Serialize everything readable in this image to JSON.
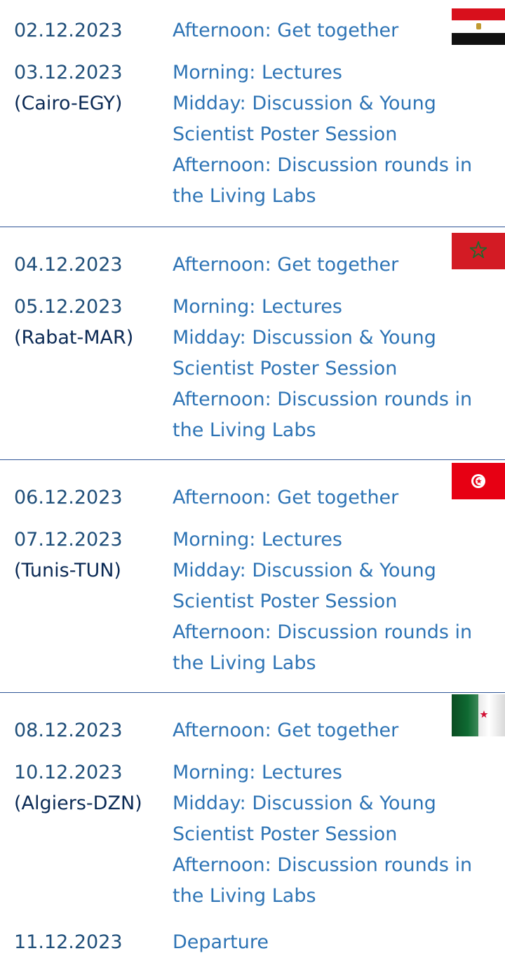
{
  "sections": [
    {
      "flag": "egypt-flag",
      "get_together": {
        "date": "02.12.2023",
        "text": "Afternoon: Get together"
      },
      "main_day": {
        "date": "03.12.2023",
        "city": "(Cairo-EGY)",
        "lines": [
          "Morning: Lectures",
          "Midday:  Discussion & Young",
          "Scientist Poster Session",
          "Afternoon: Discussion rounds in",
          "the Living Labs"
        ]
      }
    },
    {
      "flag": "morocco-flag",
      "get_together": {
        "date": "04.12.2023",
        "text": "Afternoon: Get together"
      },
      "main_day": {
        "date": "05.12.2023",
        "city": "(Rabat-MAR)",
        "lines": [
          "Morning: Lectures",
          "Midday:  Discussion & Young",
          "Scientist Poster Session",
          "Afternoon: Discussion rounds in",
          "the Living Labs"
        ]
      }
    },
    {
      "flag": "tunisia-flag",
      "get_together": {
        "date": "06.12.2023",
        "text": "Afternoon: Get together"
      },
      "main_day": {
        "date": "07.12.2023",
        "city": "(Tunis-TUN)",
        "lines": [
          "Morning: Lectures",
          "Midday: Discussion & Young",
          "Scientist Poster Session",
          "Afternoon: Discussion rounds in",
          "the Living Labs"
        ]
      }
    },
    {
      "flag": "algeria-flag",
      "get_together": {
        "date": "08.12.2023",
        "text": "Afternoon: Get together"
      },
      "main_day": {
        "date": "10.12.2023",
        "city": "(Algiers-DZN)",
        "lines": [
          "Morning: Lectures",
          "Midday: Discussion & Young",
          "Scientist Poster Session",
          "Afternoon: Discussion rounds in",
          "the Living Labs"
        ]
      }
    }
  ],
  "departure": {
    "date": "11.12.2023",
    "text": "Departure"
  },
  "colors": {
    "date_text": "#1f4e79",
    "city_text": "#0b2a55",
    "description_text": "#2e74b5",
    "divider": "#2f5597"
  }
}
